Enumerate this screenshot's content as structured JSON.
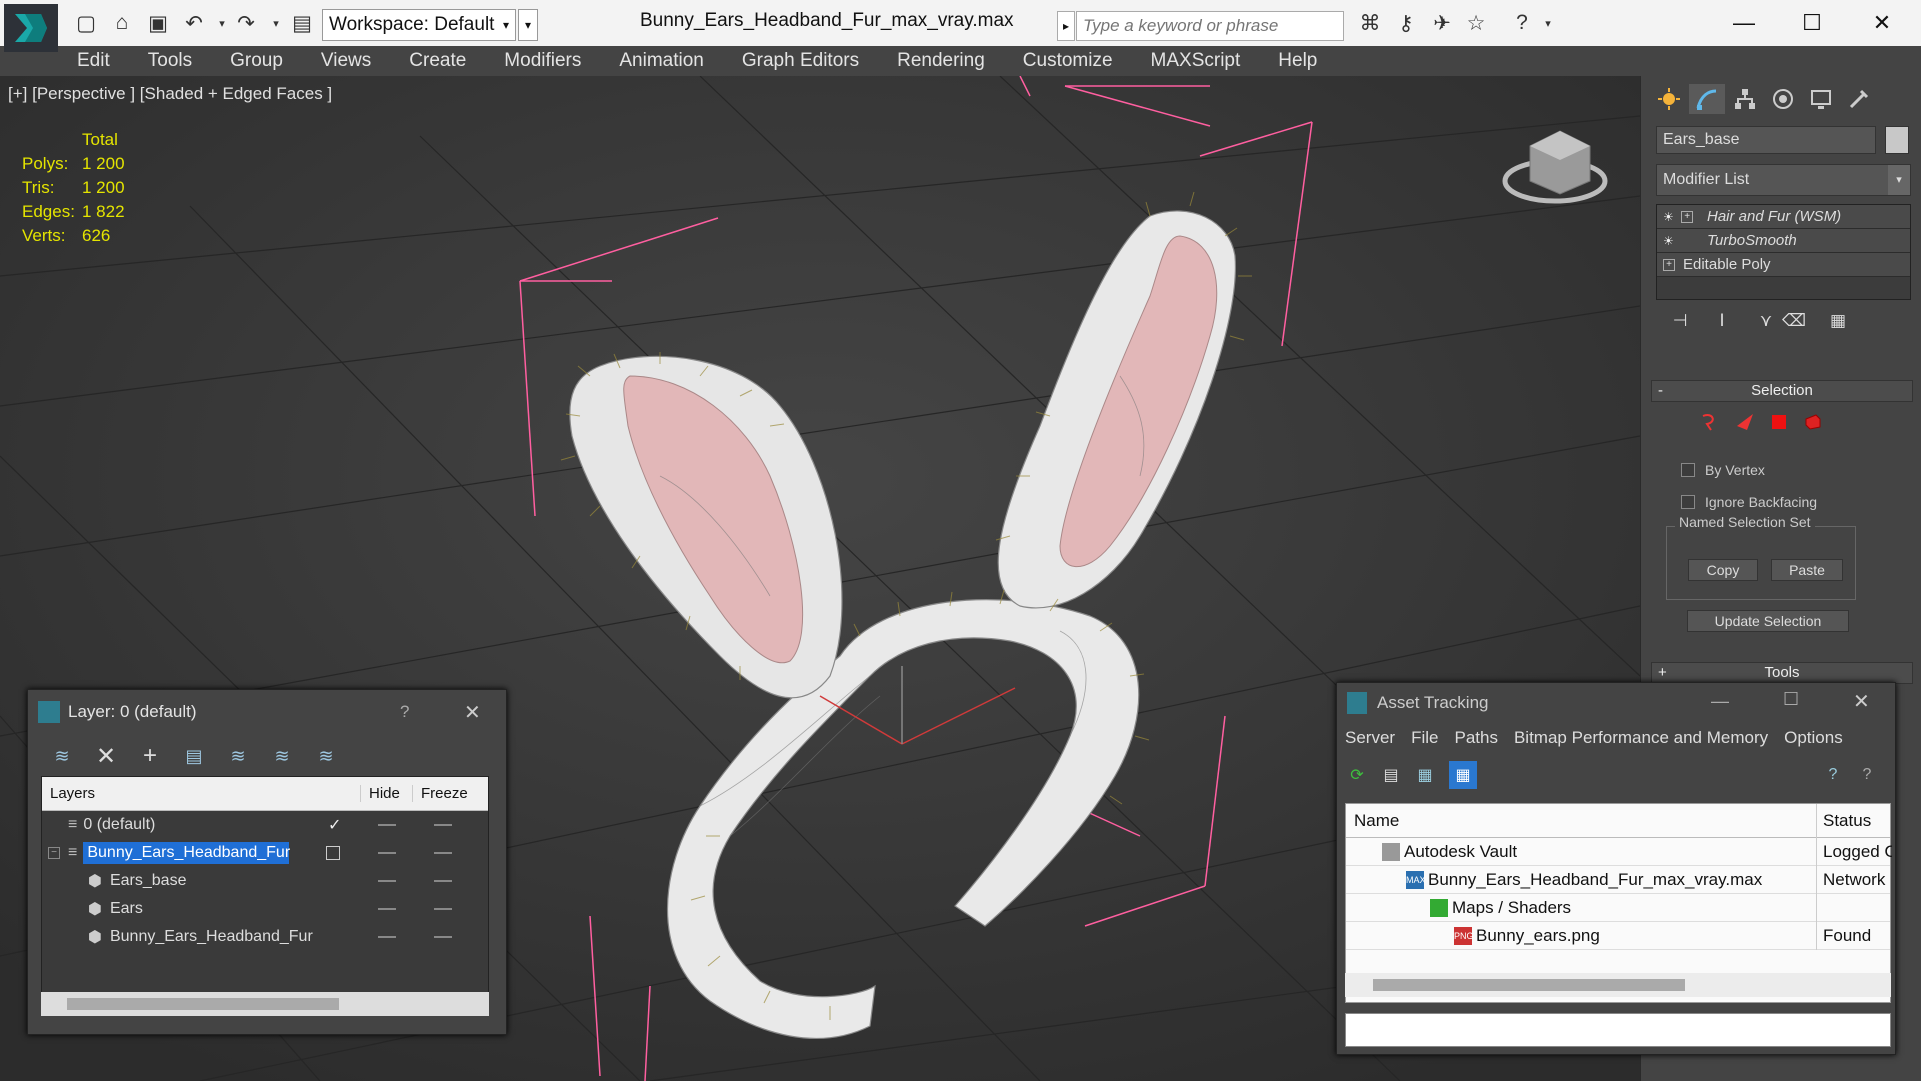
{
  "window": {
    "title": "Bunny_Ears_Headband_Fur_max_vray.max",
    "workspace": "Workspace: Default",
    "search_placeholder": "Type a keyword or phrase",
    "minimize": "—",
    "maximize": "☐",
    "close": "✕"
  },
  "menu": [
    "Edit",
    "Tools",
    "Group",
    "Views",
    "Create",
    "Modifiers",
    "Animation",
    "Graph Editors",
    "Rendering",
    "Customize",
    "MAXScript",
    "Help"
  ],
  "viewport": {
    "label": "[+] [Perspective ] [Shaded + Edged Faces ]",
    "stats": {
      "header": "Total",
      "rows": [
        {
          "key": "Polys:",
          "value": "1 200"
        },
        {
          "key": "Tris:",
          "value": "1 200"
        },
        {
          "key": "Edges:",
          "value": "1 822"
        },
        {
          "key": "Verts:",
          "value": "626"
        }
      ]
    }
  },
  "command_panel": {
    "object_name": "Ears_base",
    "modifier_list": "Modifier List",
    "stack": [
      {
        "label": "Hair and Fur (WSM)",
        "italic": true
      },
      {
        "label": "TurboSmooth",
        "italic": true
      },
      {
        "label": "Editable Poly",
        "italic": false
      }
    ],
    "selection_title": "Selection",
    "selection_sign": "-",
    "by_vertex": "By Vertex",
    "ignore_backfacing": "Ignore Backfacing",
    "named_selection_set": "Named Selection Set",
    "copy": "Copy",
    "paste": "Paste",
    "update_selection": "Update Selection",
    "tools_title": "Tools",
    "tools_sign": "+"
  },
  "layer_dialog": {
    "title": "Layer: 0 (default)",
    "help": "?",
    "close": "✕",
    "columns": {
      "layers": "Layers",
      "hide": "Hide",
      "freeze": "Freeze"
    },
    "rows": [
      {
        "name": "0 (default)",
        "indent": 0,
        "active": true
      },
      {
        "name": "Bunny_Ears_Headband_Fur",
        "indent": 0,
        "selected": true
      },
      {
        "name": "Ears_base",
        "indent": 1
      },
      {
        "name": "Ears",
        "indent": 1
      },
      {
        "name": "Bunny_Ears_Headband_Fur",
        "indent": 1
      }
    ]
  },
  "asset_tracking": {
    "title": "Asset Tracking",
    "menu": [
      "Server",
      "File",
      "Paths",
      "Bitmap Performance and Memory",
      "Options"
    ],
    "columns": {
      "name": "Name",
      "status": "Status"
    },
    "rows": [
      {
        "name": "Autodesk Vault",
        "status": "Logged Out",
        "indent": 1
      },
      {
        "name": "Bunny_Ears_Headband_Fur_max_vray.max",
        "status": "Network",
        "indent": 2
      },
      {
        "name": "Maps / Shaders",
        "status": "",
        "indent": 3
      },
      {
        "name": "Bunny_ears.png",
        "status": "Found",
        "indent": 4
      }
    ]
  },
  "colors": {
    "accent": "#1f6fd6",
    "viewport_bg": "#3a3a3a",
    "stats_yellow": "#e4e400",
    "bbox_pink": "#ff5fa0"
  }
}
